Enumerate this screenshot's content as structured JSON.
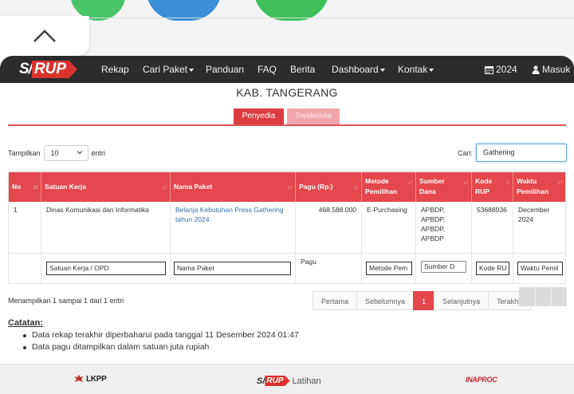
{
  "navbar": {
    "logo_s": "S/",
    "logo_rup": "RUP",
    "items": [
      {
        "label": "Rekap"
      },
      {
        "label": "Cari Paket"
      },
      {
        "label": "Panduan"
      },
      {
        "label": "FAQ"
      },
      {
        "label": "Berita"
      },
      {
        "label": "Dashboard"
      },
      {
        "label": "Kontak"
      }
    ],
    "year": "2024",
    "login": "Masuk"
  },
  "header": {
    "title": "KAB. TANGERANG"
  },
  "tabs": {
    "penyedia": "Penyedia",
    "swakelola": "Swakelola"
  },
  "length_menu": {
    "prefix": "Tampilkan",
    "value": "10",
    "suffix": "entri"
  },
  "search": {
    "label": "Cari:",
    "value": "Gathering"
  },
  "table": {
    "headers": {
      "no": "No",
      "satuan": "Satuan Kerja",
      "nama": "Nama Paket",
      "pagu": "Pagu (Rp.)",
      "metode_1": "Metode",
      "metode_2": "Pemilihan",
      "sumber_1": "Sumber",
      "sumber_2": "Dana",
      "kode_1": "Kode",
      "kode_2": "RUP",
      "waktu_1": "Waktu",
      "waktu_2": "Pemilihan"
    },
    "row": {
      "no": "1",
      "satuan": "Dinas Komunikasi dan Informatika",
      "nama_1": "Belanja Kebutuhan Press Gathering",
      "nama_2": "tahun 2024",
      "pagu": "468.588.000",
      "metode": "E-Purchasing",
      "sumber_1": "APBDP,",
      "sumber_2": "APBDP,",
      "sumber_3": "APBDP,",
      "sumber_4": "APBDP",
      "kode": "53688936",
      "waktu_1": "December",
      "waktu_2": "2024"
    },
    "filters": {
      "satuan": "Satuan Kerja / OPD",
      "nama": "Nama Paket",
      "pagu": "Pagu",
      "metode": "Metode Pem",
      "sumber": "Sumber D",
      "kode": "Kode RU",
      "waktu": "Waktu Pemil"
    }
  },
  "info": "Menampilkan 1 sampai 1 dari 1 entri",
  "pagination": {
    "first": "Pertama",
    "prev": "Sebelumnya",
    "current": "1",
    "next": "Selanjutnya",
    "last": "Terakhir"
  },
  "notes": {
    "title": "Catatan:",
    "items": [
      "Data rekap terakhir diperbaharui pada tanggal 11 Desember 2024 01:47",
      "Data pagu ditampilkan dalam satuan juta rupiah"
    ]
  },
  "footer": {
    "lkpp": "LKPP",
    "sirup_s": "S/",
    "sirup_rup": "RUP",
    "latihan": "Latihan",
    "inaproc": "INAPROC"
  },
  "colors": {
    "accent": "#e4474d",
    "navbar": "#2c2c2c"
  }
}
